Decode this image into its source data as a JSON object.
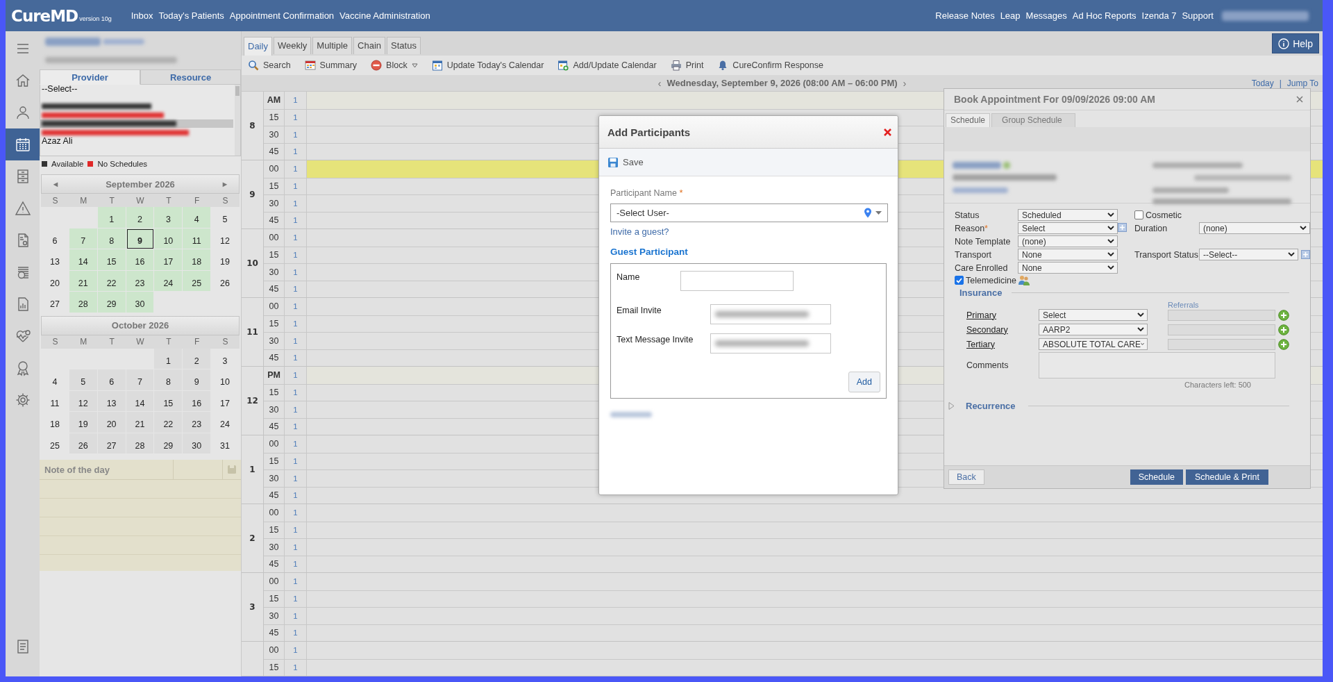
{
  "top_bar": {
    "logo": "CureMD",
    "version": "version 10g",
    "nav_left": [
      "Inbox",
      "Today's Patients",
      "Appointment Confirmation",
      "Vaccine Administration"
    ],
    "nav_right": [
      "Release Notes",
      "Leap",
      "Messages",
      "Ad Hoc Reports",
      "Izenda 7",
      "Support"
    ],
    "user_redacted": true
  },
  "rail": [
    {
      "kind": "menu",
      "selected": false
    },
    {
      "kind": "home",
      "selected": false
    },
    {
      "kind": "person",
      "selected": false
    },
    {
      "kind": "calendar",
      "selected": true
    },
    {
      "kind": "cabinet",
      "selected": false
    },
    {
      "kind": "warning",
      "selected": false
    },
    {
      "kind": "bill",
      "selected": false
    },
    {
      "kind": "money",
      "selected": false
    },
    {
      "kind": "report",
      "selected": false
    },
    {
      "kind": "health",
      "selected": false
    },
    {
      "kind": "award",
      "selected": false
    },
    {
      "kind": "settings",
      "selected": false
    }
  ],
  "rail_bottom": [
    {
      "kind": "notes",
      "selected": false
    }
  ],
  "left_panel": {
    "header_redacted": true,
    "tabs": [
      {
        "label": "Provider",
        "selected": true
      },
      {
        "label": "Resource",
        "selected": false
      }
    ],
    "provider_list": [
      {
        "kind": "text",
        "label": "--Select--",
        "color": "#111111",
        "selected": false
      },
      {
        "kind": "redacted",
        "color": "#333333",
        "selected": false
      },
      {
        "kind": "redacted",
        "color": "#e03030",
        "selected": false
      },
      {
        "kind": "redacted",
        "color": "#333333",
        "selected": true
      },
      {
        "kind": "redacted",
        "color": "#e03030",
        "selected": false
      },
      {
        "kind": "text",
        "label": "Azaz Ali",
        "color": "#111111",
        "selected": false
      }
    ],
    "legend": [
      {
        "label": "Available",
        "color": "#333333"
      },
      {
        "label": "No Schedules",
        "color": "#e02828"
      }
    ],
    "months": [
      {
        "title": "September 2026",
        "prev": "◄",
        "next": "►",
        "weekdays": [
          "S",
          "M",
          "T",
          "W",
          "T",
          "F",
          "S"
        ],
        "weeks": [
          [
            {
              "kind": "blank"
            },
            {
              "kind": "blank"
            },
            {
              "kind": "day",
              "label": "1",
              "available": true,
              "selected": false
            },
            {
              "kind": "day",
              "label": "2",
              "available": true,
              "selected": false
            },
            {
              "kind": "day",
              "label": "3",
              "available": true,
              "selected": false
            },
            {
              "kind": "day",
              "label": "4",
              "available": true,
              "selected": false
            },
            {
              "kind": "day",
              "label": "5",
              "available": false,
              "selected": false
            }
          ],
          [
            {
              "kind": "day",
              "label": "6",
              "available": false,
              "selected": false
            },
            {
              "kind": "day",
              "label": "7",
              "available": true,
              "selected": false
            },
            {
              "kind": "day",
              "label": "8",
              "available": true,
              "selected": false
            },
            {
              "kind": "day",
              "label": "9",
              "available": true,
              "selected": true
            },
            {
              "kind": "day",
              "label": "10",
              "available": true,
              "selected": false
            },
            {
              "kind": "day",
              "label": "11",
              "available": true,
              "selected": false
            },
            {
              "kind": "day",
              "label": "12",
              "available": false,
              "selected": false
            }
          ],
          [
            {
              "kind": "day",
              "label": "13",
              "available": false,
              "selected": false
            },
            {
              "kind": "day",
              "label": "14",
              "available": true,
              "selected": false
            },
            {
              "kind": "day",
              "label": "15",
              "available": true,
              "selected": false
            },
            {
              "kind": "day",
              "label": "16",
              "available": true,
              "selected": false
            },
            {
              "kind": "day",
              "label": "17",
              "available": true,
              "selected": false
            },
            {
              "kind": "day",
              "label": "18",
              "available": true,
              "selected": false
            },
            {
              "kind": "day",
              "label": "19",
              "available": false,
              "selected": false
            }
          ],
          [
            {
              "kind": "day",
              "label": "20",
              "available": false,
              "selected": false
            },
            {
              "kind": "day",
              "label": "21",
              "available": true,
              "selected": false
            },
            {
              "kind": "day",
              "label": "22",
              "available": true,
              "selected": false
            },
            {
              "kind": "day",
              "label": "23",
              "available": true,
              "selected": false
            },
            {
              "kind": "day",
              "label": "24",
              "available": true,
              "selected": false
            },
            {
              "kind": "day",
              "label": "25",
              "available": true,
              "selected": false
            },
            {
              "kind": "day",
              "label": "26",
              "available": false,
              "selected": false
            }
          ],
          [
            {
              "kind": "day",
              "label": "27",
              "available": false,
              "selected": false
            },
            {
              "kind": "day",
              "label": "28",
              "available": true,
              "selected": false
            },
            {
              "kind": "day",
              "label": "29",
              "available": true,
              "selected": false
            },
            {
              "kind": "day",
              "label": "30",
              "available": true,
              "selected": false
            },
            {
              "kind": "blank"
            },
            {
              "kind": "blank"
            },
            {
              "kind": "blank"
            }
          ]
        ]
      },
      {
        "title": "October 2026",
        "weekdays": [
          "S",
          "M",
          "T",
          "W",
          "T",
          "F",
          "S"
        ],
        "weeks": [
          [
            {
              "kind": "blank"
            },
            {
              "kind": "blank"
            },
            {
              "kind": "blank"
            },
            {
              "kind": "blank"
            },
            {
              "kind": "day",
              "label": "1",
              "available": false,
              "selected": false
            },
            {
              "kind": "day",
              "label": "2",
              "available": false,
              "selected": false
            },
            {
              "kind": "day",
              "label": "3",
              "available": false,
              "selected": false
            }
          ],
          [
            {
              "kind": "day",
              "label": "4",
              "available": false,
              "selected": false
            },
            {
              "kind": "day",
              "label": "5",
              "available": false,
              "selected": false
            },
            {
              "kind": "day",
              "label": "6",
              "available": false,
              "selected": false
            },
            {
              "kind": "day",
              "label": "7",
              "available": false,
              "selected": false
            },
            {
              "kind": "day",
              "label": "8",
              "available": false,
              "selected": false
            },
            {
              "kind": "day",
              "label": "9",
              "available": false,
              "selected": false
            },
            {
              "kind": "day",
              "label": "10",
              "available": false,
              "selected": false
            }
          ],
          [
            {
              "kind": "day",
              "label": "11",
              "available": false,
              "selected": false
            },
            {
              "kind": "day",
              "label": "12",
              "available": false,
              "selected": false
            },
            {
              "kind": "day",
              "label": "13",
              "available": false,
              "selected": false
            },
            {
              "kind": "day",
              "label": "14",
              "available": false,
              "selected": false
            },
            {
              "kind": "day",
              "label": "15",
              "available": false,
              "selected": false
            },
            {
              "kind": "day",
              "label": "16",
              "available": false,
              "selected": false
            },
            {
              "kind": "day",
              "label": "17",
              "available": false,
              "selected": false
            }
          ],
          [
            {
              "kind": "day",
              "label": "18",
              "available": false,
              "selected": false
            },
            {
              "kind": "day",
              "label": "19",
              "available": false,
              "selected": false
            },
            {
              "kind": "day",
              "label": "20",
              "available": false,
              "selected": false
            },
            {
              "kind": "day",
              "label": "21",
              "available": false,
              "selected": false
            },
            {
              "kind": "day",
              "label": "22",
              "available": false,
              "selected": false
            },
            {
              "kind": "day",
              "label": "23",
              "available": false,
              "selected": false
            },
            {
              "kind": "day",
              "label": "24",
              "available": false,
              "selected": false
            }
          ],
          [
            {
              "kind": "day",
              "label": "25",
              "available": false,
              "selected": false
            },
            {
              "kind": "day",
              "label": "26",
              "available": false,
              "selected": false
            },
            {
              "kind": "day",
              "label": "27",
              "available": false,
              "selected": false
            },
            {
              "kind": "day",
              "label": "28",
              "available": false,
              "selected": false
            },
            {
              "kind": "day",
              "label": "29",
              "available": false,
              "selected": false
            },
            {
              "kind": "day",
              "label": "30",
              "available": false,
              "selected": false
            },
            {
              "kind": "day",
              "label": "31",
              "available": false,
              "selected": false
            }
          ]
        ]
      }
    ],
    "note_of_day": {
      "title": "Note of the day"
    }
  },
  "schedule": {
    "tabs": [
      {
        "label": "Daily",
        "selected": true
      },
      {
        "label": "Weekly",
        "selected": false
      },
      {
        "label": "Multiple",
        "selected": false
      },
      {
        "label": "Chain",
        "selected": false
      },
      {
        "label": "Status",
        "selected": false
      }
    ],
    "help_button": "Help",
    "toolbar": [
      {
        "kind": "search",
        "label": "Search"
      },
      {
        "kind": "summary",
        "label": "Summary"
      },
      {
        "kind": "block",
        "label": "Block",
        "dropdown": true
      },
      {
        "kind": "update",
        "label": "Update Today's Calendar"
      },
      {
        "kind": "addcal",
        "label": "Add/Update Calendar"
      },
      {
        "kind": "print",
        "label": "Print"
      },
      {
        "kind": "bell",
        "label": "CureConfirm Response"
      }
    ],
    "date_nav": {
      "prev": "‹",
      "title": "Wednesday, September 9, 2026 (08:00 AM – 06:00 PM)",
      "next": "›",
      "links": [
        "Today",
        "Jump To"
      ],
      "separator": "|"
    },
    "hours": [
      {
        "label": "8",
        "slots": [
          {
            "kind": "meridiem",
            "label": "AM",
            "count": "1",
            "selected": false
          },
          {
            "kind": "slot",
            "label": "15",
            "count": "1",
            "selected": false
          },
          {
            "kind": "slot",
            "label": "30",
            "count": "1",
            "selected": false
          },
          {
            "kind": "slot",
            "label": "45",
            "count": "1",
            "selected": false
          }
        ]
      },
      {
        "label": "9",
        "slots": [
          {
            "kind": "slot",
            "label": "00",
            "count": "1",
            "selected": true
          },
          {
            "kind": "slot",
            "label": "15",
            "count": "1",
            "selected": false
          },
          {
            "kind": "slot",
            "label": "30",
            "count": "1",
            "selected": false
          },
          {
            "kind": "slot",
            "label": "45",
            "count": "1",
            "selected": false
          }
        ]
      },
      {
        "label": "10",
        "slots": [
          {
            "kind": "slot",
            "label": "00",
            "count": "1",
            "selected": false
          },
          {
            "kind": "slot",
            "label": "15",
            "count": "1",
            "selected": false
          },
          {
            "kind": "slot",
            "label": "30",
            "count": "1",
            "selected": false
          },
          {
            "kind": "slot",
            "label": "45",
            "count": "1",
            "selected": false
          }
        ]
      },
      {
        "label": "11",
        "slots": [
          {
            "kind": "slot",
            "label": "00",
            "count": "1",
            "selected": false
          },
          {
            "kind": "slot",
            "label": "15",
            "count": "1",
            "selected": false
          },
          {
            "kind": "slot",
            "label": "30",
            "count": "1",
            "selected": false
          },
          {
            "kind": "slot",
            "label": "45",
            "count": "1",
            "selected": false
          }
        ]
      },
      {
        "label": "12",
        "slots": [
          {
            "kind": "meridiem",
            "label": "PM",
            "count": "1",
            "selected": false
          },
          {
            "kind": "slot",
            "label": "15",
            "count": "1",
            "selected": false
          },
          {
            "kind": "slot",
            "label": "30",
            "count": "1",
            "selected": false
          },
          {
            "kind": "slot",
            "label": "45",
            "count": "1",
            "selected": false
          }
        ]
      },
      {
        "label": "1",
        "slots": [
          {
            "kind": "slot",
            "label": "00",
            "count": "1",
            "selected": false
          },
          {
            "kind": "slot",
            "label": "15",
            "count": "1",
            "selected": false
          },
          {
            "kind": "slot",
            "label": "30",
            "count": "1",
            "selected": false
          },
          {
            "kind": "slot",
            "label": "45",
            "count": "1",
            "selected": false
          }
        ]
      },
      {
        "label": "2",
        "slots": [
          {
            "kind": "slot",
            "label": "00",
            "count": "1",
            "selected": false
          },
          {
            "kind": "slot",
            "label": "15",
            "count": "1",
            "selected": false
          },
          {
            "kind": "slot",
            "label": "30",
            "count": "1",
            "selected": false
          },
          {
            "kind": "slot",
            "label": "45",
            "count": "1",
            "selected": false
          }
        ]
      },
      {
        "label": "3",
        "slots": [
          {
            "kind": "slot",
            "label": "00",
            "count": "1",
            "selected": false
          },
          {
            "kind": "slot",
            "label": "15",
            "count": "1",
            "selected": false
          },
          {
            "kind": "slot",
            "label": "30",
            "count": "1",
            "selected": false
          },
          {
            "kind": "slot",
            "label": "45",
            "count": "1",
            "selected": false
          }
        ]
      },
      {
        "slots": [
          {
            "kind": "slot",
            "label": "00",
            "count": "1",
            "selected": false
          },
          {
            "kind": "slot",
            "label": "15",
            "count": "1",
            "selected": false
          }
        ]
      }
    ]
  },
  "dialog": {
    "title": "Add Participants",
    "save": "Save",
    "participant": {
      "label": "Participant Name",
      "required_mark": "*",
      "value": "-Select User-"
    },
    "invite_link": "Invite a guest?",
    "guest": {
      "title": "Guest Participant",
      "fields": [
        {
          "kind": "name",
          "label": "Name",
          "redacted": false
        },
        {
          "kind": "invite",
          "label": "Email Invite",
          "redacted": true
        },
        {
          "kind": "invite",
          "label": "Text Message Invite",
          "redacted": true
        }
      ],
      "add_button": "Add"
    },
    "footer_redacted": true
  },
  "booking": {
    "title": "Book Appointment For 09/09/2026 09:00 AM",
    "tabs": [
      {
        "label": "Schedule",
        "selected": true
      },
      {
        "label": "Group Schedule",
        "selected": false
      }
    ],
    "patient_redacted": true,
    "rows": [
      {
        "left": {
          "label": "Status",
          "value": "Scheduled",
          "add": false
        },
        "right": {
          "kind": "checkbox",
          "label": "Cosmetic",
          "checked": false
        }
      },
      {
        "left": {
          "label": "Reason",
          "required_mark": "*",
          "value": "Select",
          "add": true
        },
        "right": {
          "kind": "select",
          "label": "Duration",
          "value": "(none)",
          "add": false
        }
      },
      {
        "left": {
          "label": "Note Template",
          "value": "(none)",
          "add": false
        }
      },
      {
        "left": {
          "label": "Transport",
          "value": "None",
          "add": false
        },
        "right": {
          "kind": "select",
          "label": "Transport Status",
          "value": "--Select--",
          "add": true
        }
      },
      {
        "left": {
          "label": "Care Enrolled",
          "value": "None",
          "add": false
        }
      }
    ],
    "telemedicine": {
      "label": "Telemedicine",
      "checked": true
    },
    "insurance": {
      "title": "Insurance",
      "referrals_label": "Referrals",
      "rows": [
        {
          "label": "Primary",
          "value": "Select"
        },
        {
          "label": "Secondary",
          "value": "AARP2"
        },
        {
          "label": "Tertiary",
          "value": "ABSOLUTE TOTAL CARE"
        }
      ]
    },
    "comments": {
      "label": "Comments",
      "counter": "Characters left: 500"
    },
    "recurrence": {
      "title": "Recurrence",
      "expanded": false
    },
    "back_button": "Back",
    "action_buttons": [
      "Schedule",
      "Schedule & Print"
    ]
  }
}
